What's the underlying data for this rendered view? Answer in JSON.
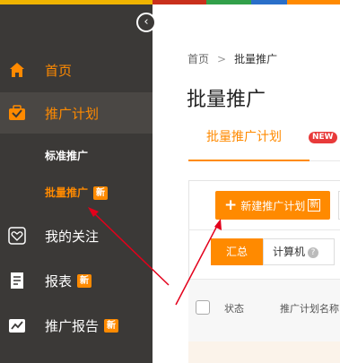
{
  "colors": {
    "accent": "#ff8a00",
    "sidebar_bg": "#3b3937",
    "arrow": "#e3001b",
    "new_badge": "#e83a3a"
  },
  "sidebar": {
    "collapse_icon": "‹",
    "items": [
      {
        "label": "首页",
        "icon": "home-icon"
      },
      {
        "label": "推广计划",
        "icon": "campaign-icon"
      },
      {
        "label": "我的关注",
        "icon": "heart-icon"
      },
      {
        "label": "报表",
        "icon": "report-icon",
        "badge": "新"
      },
      {
        "label": "推广报告",
        "icon": "report-chart-icon",
        "badge": "新"
      }
    ],
    "sub_items": [
      {
        "label": "标准推广"
      },
      {
        "label": "批量推广",
        "badge": "新"
      }
    ]
  },
  "breadcrumb": {
    "home": "首页",
    "separator": ">",
    "current": "批量推广"
  },
  "page_title": "批量推广",
  "tab": {
    "label": "批量推广计划",
    "badge": "NEW"
  },
  "toolbar": {
    "create_plus": "+",
    "create_label": "新建推广计划",
    "create_badge": "新"
  },
  "segments": {
    "summary": "汇总",
    "pc": "计算机",
    "help": "?"
  },
  "table": {
    "columns": [
      "状态",
      "推广计划名称"
    ]
  }
}
